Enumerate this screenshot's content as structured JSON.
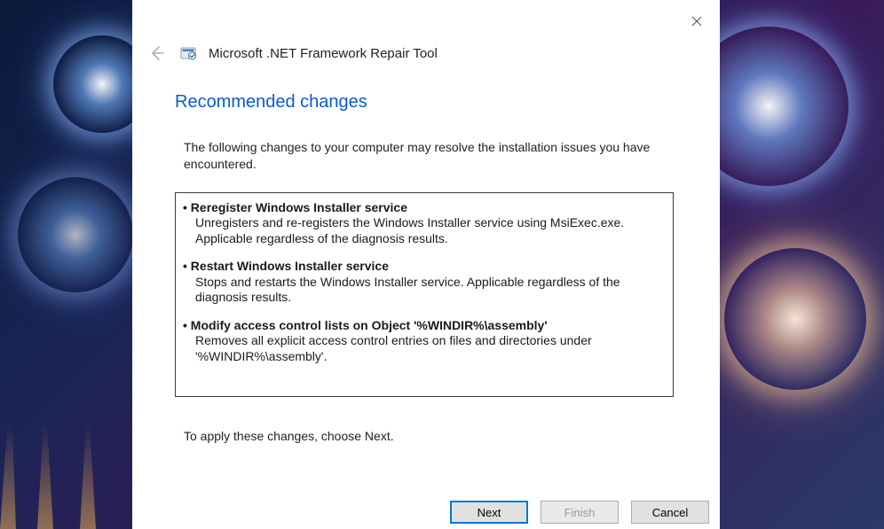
{
  "app": {
    "title": "Microsoft .NET Framework Repair Tool"
  },
  "page": {
    "heading": "Recommended changes",
    "intro": "The following changes to your computer may resolve the installation issues you have encountered.",
    "apply_note": "To apply these changes, choose Next."
  },
  "changes": [
    {
      "title": "Reregister Windows Installer service",
      "desc": "Unregisters and re-registers the Windows Installer service using MsiExec.exe. Applicable regardless of the diagnosis results."
    },
    {
      "title": "Restart Windows Installer service",
      "desc": "Stops and restarts the Windows Installer service. Applicable regardless of the diagnosis results."
    },
    {
      "title": "Modify access control lists on Object '%WINDIR%\\assembly'",
      "desc": "Removes all explicit access control entries on files and directories under '%WINDIR%\\assembly'."
    }
  ],
  "buttons": {
    "next": "Next",
    "finish": "Finish",
    "cancel": "Cancel"
  }
}
